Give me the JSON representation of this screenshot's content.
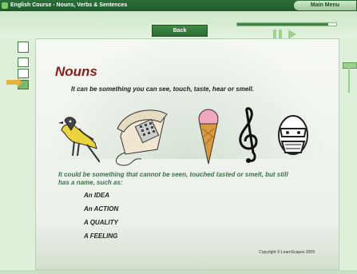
{
  "window": {
    "title": "English Course - Nouns, Verbs & Sentences",
    "main_menu_label": "Main Menu"
  },
  "toolbar": {
    "back_label": "Back",
    "progress": 0.92
  },
  "lesson": {
    "heading": "Nouns",
    "subtitle": "It can be something you can see, touch, taste, hear or smell.",
    "images": [
      "bird",
      "telephone",
      "ice-cream-cone",
      "treble-clef",
      "face-mask"
    ],
    "description": "It could be something that cannot be seen, touched tasted or smelt, but still has a name, such as:",
    "examples": [
      "An IDEA",
      "An ACTION",
      "A QUALITY",
      "A FEELING"
    ],
    "copyright": "Copyright © LearnScapes 2009"
  },
  "colors": {
    "accent": "#2b6b33",
    "heading": "#8b1d1a",
    "description": "#3d7048",
    "highlight": "#e5b33d"
  }
}
